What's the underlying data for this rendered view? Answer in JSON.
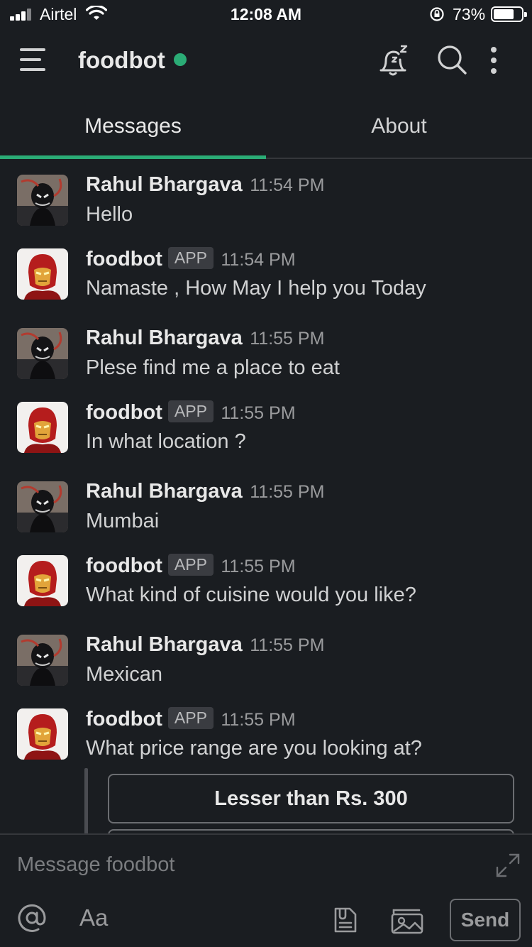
{
  "status_bar": {
    "carrier": "Airtel",
    "time": "12:08 AM",
    "battery_percent": "73%",
    "battery_level": 0.73
  },
  "header": {
    "title": "foodbot",
    "presence_color": "#2bac76",
    "icons": [
      "menu-icon",
      "snooze-bell-icon",
      "search-icon",
      "more-vertical-icon"
    ]
  },
  "tabs": [
    {
      "label": "Messages",
      "active": true
    },
    {
      "label": "About",
      "active": false
    }
  ],
  "messages": [
    {
      "sender": "Rahul Bhargava",
      "is_app": false,
      "time": "11:54 PM",
      "text": "Hello",
      "avatar": "user-avatar"
    },
    {
      "sender": "foodbot",
      "is_app": true,
      "badge": "APP",
      "time": "11:54 PM",
      "text": "Namaste , How May I help you Today",
      "avatar": "bot-avatar"
    },
    {
      "sender": "Rahul Bhargava",
      "is_app": false,
      "time": "11:55 PM",
      "text": "Plese find me a place to eat",
      "avatar": "user-avatar"
    },
    {
      "sender": "foodbot",
      "is_app": true,
      "badge": "APP",
      "time": "11:55 PM",
      "text": "In what location ?",
      "avatar": "bot-avatar"
    },
    {
      "sender": "Rahul Bhargava",
      "is_app": false,
      "time": "11:55 PM",
      "text": "Mumbai",
      "avatar": "user-avatar"
    },
    {
      "sender": "foodbot",
      "is_app": true,
      "badge": "APP",
      "time": "11:55 PM",
      "text": "What kind of cuisine would you like?",
      "avatar": "bot-avatar"
    },
    {
      "sender": "Rahul Bhargava",
      "is_app": false,
      "time": "11:55 PM",
      "text": "Mexican",
      "avatar": "user-avatar"
    },
    {
      "sender": "foodbot",
      "is_app": true,
      "badge": "APP",
      "time": "11:55 PM",
      "text": "What price range are you looking at?",
      "avatar": "bot-avatar"
    }
  ],
  "options": [
    {
      "label": "Lesser than Rs. 300"
    },
    {
      "label": ""
    }
  ],
  "composer": {
    "placeholder": "Message foodbot",
    "format_label": "Aa",
    "send_label": "Send"
  },
  "colors": {
    "background": "#1a1d21",
    "accent": "#2bac76",
    "text": "#d1d2d3"
  }
}
